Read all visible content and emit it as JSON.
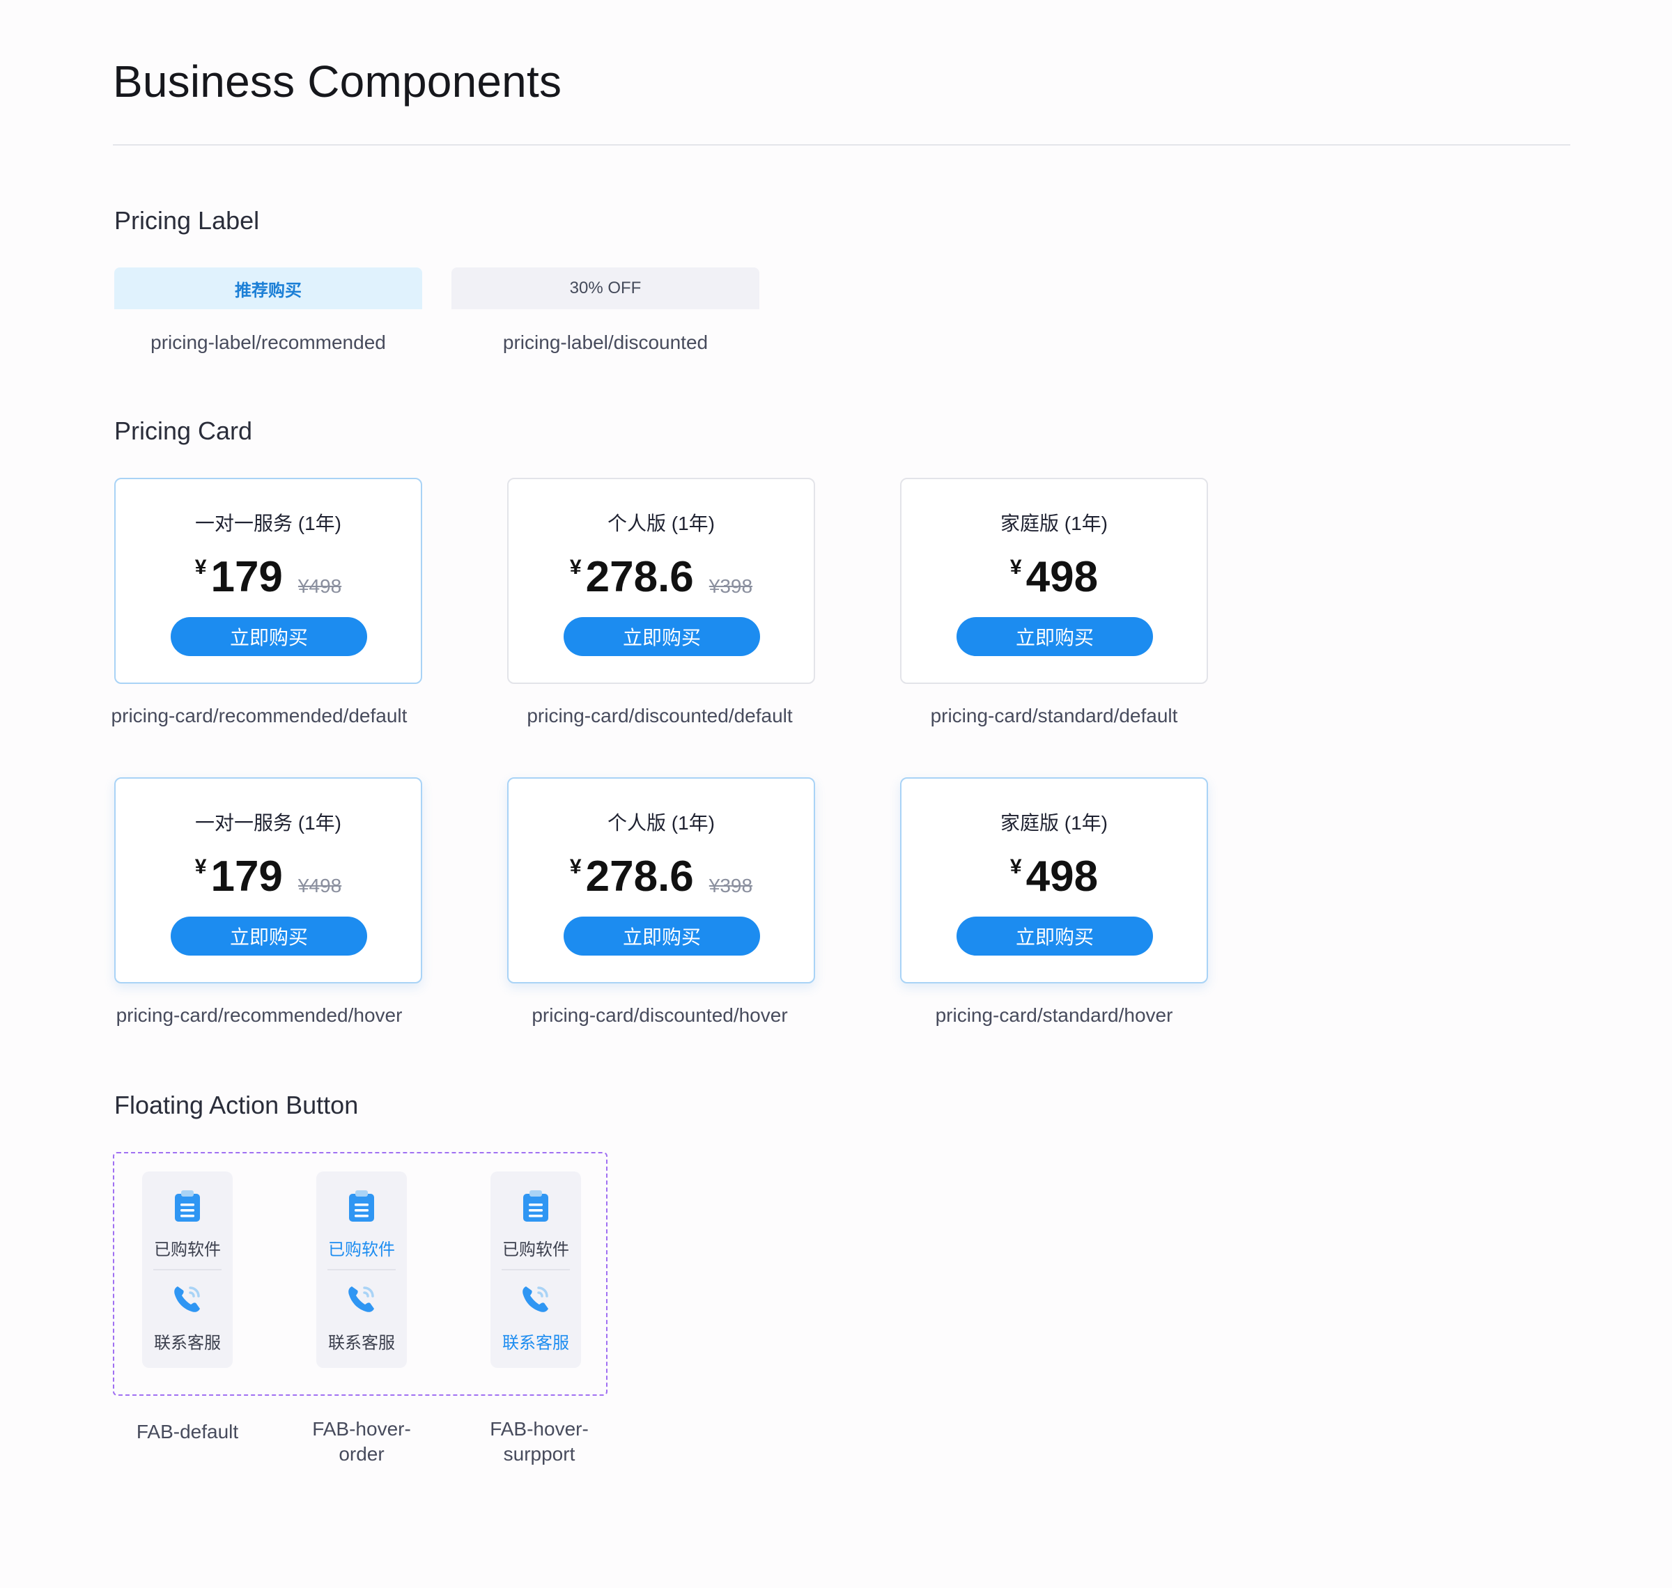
{
  "page": {
    "title": "Business Components"
  },
  "colors": {
    "accent": "#1c8cf0",
    "recommended_bg": "#e0f2fd",
    "discounted_bg": "#f1f1f6",
    "frame_dash": "#a070f2"
  },
  "pricing_label": {
    "heading": "Pricing Label",
    "recommended": {
      "text": "推荐购买",
      "caption": "pricing-label/recommended"
    },
    "discounted": {
      "text": "30% OFF",
      "caption": "pricing-label/discounted"
    }
  },
  "pricing_card": {
    "heading": "Pricing Card",
    "cards": [
      {
        "title": "一对一服务 (1年)",
        "currency": "¥",
        "price": "179",
        "original": "¥498",
        "button": "立即购买",
        "caption": "pricing-card/recommended/default"
      },
      {
        "title": "个人版 (1年)",
        "currency": "¥",
        "price": "278.6",
        "original": "¥398",
        "button": "立即购买",
        "caption": "pricing-card/discounted/default"
      },
      {
        "title": "家庭版 (1年)",
        "currency": "¥",
        "price": "498",
        "original": "",
        "button": "立即购买",
        "caption": "pricing-card/standard/default"
      },
      {
        "title": "一对一服务 (1年)",
        "currency": "¥",
        "price": "179",
        "original": "¥498",
        "button": "立即购买",
        "caption": "pricing-card/recommended/hover"
      },
      {
        "title": "个人版 (1年)",
        "currency": "¥",
        "price": "278.6",
        "original": "¥398",
        "button": "立即购买",
        "caption": "pricing-card/discounted/hover"
      },
      {
        "title": "家庭版 (1年)",
        "currency": "¥",
        "price": "498",
        "original": "",
        "button": "立即购买",
        "caption": "pricing-card/standard/hover"
      }
    ]
  },
  "fab": {
    "heading": "Floating Action Button",
    "items": [
      {
        "order_label": "已购软件",
        "support_label": "联系客服",
        "order_icon": "clipboard-icon",
        "support_icon": "phone-icon",
        "active": "none",
        "caption_line1": "FAB-default",
        "caption_line2": ""
      },
      {
        "order_label": "已购软件",
        "support_label": "联系客服",
        "order_icon": "clipboard-icon",
        "support_icon": "phone-icon",
        "active": "order",
        "caption_line1": "FAB-hover-",
        "caption_line2": "order"
      },
      {
        "order_label": "已购软件",
        "support_label": "联系客服",
        "order_icon": "clipboard-icon",
        "support_icon": "phone-icon",
        "active": "support",
        "caption_line1": "FAB-hover-",
        "caption_line2": "surpport"
      }
    ]
  }
}
